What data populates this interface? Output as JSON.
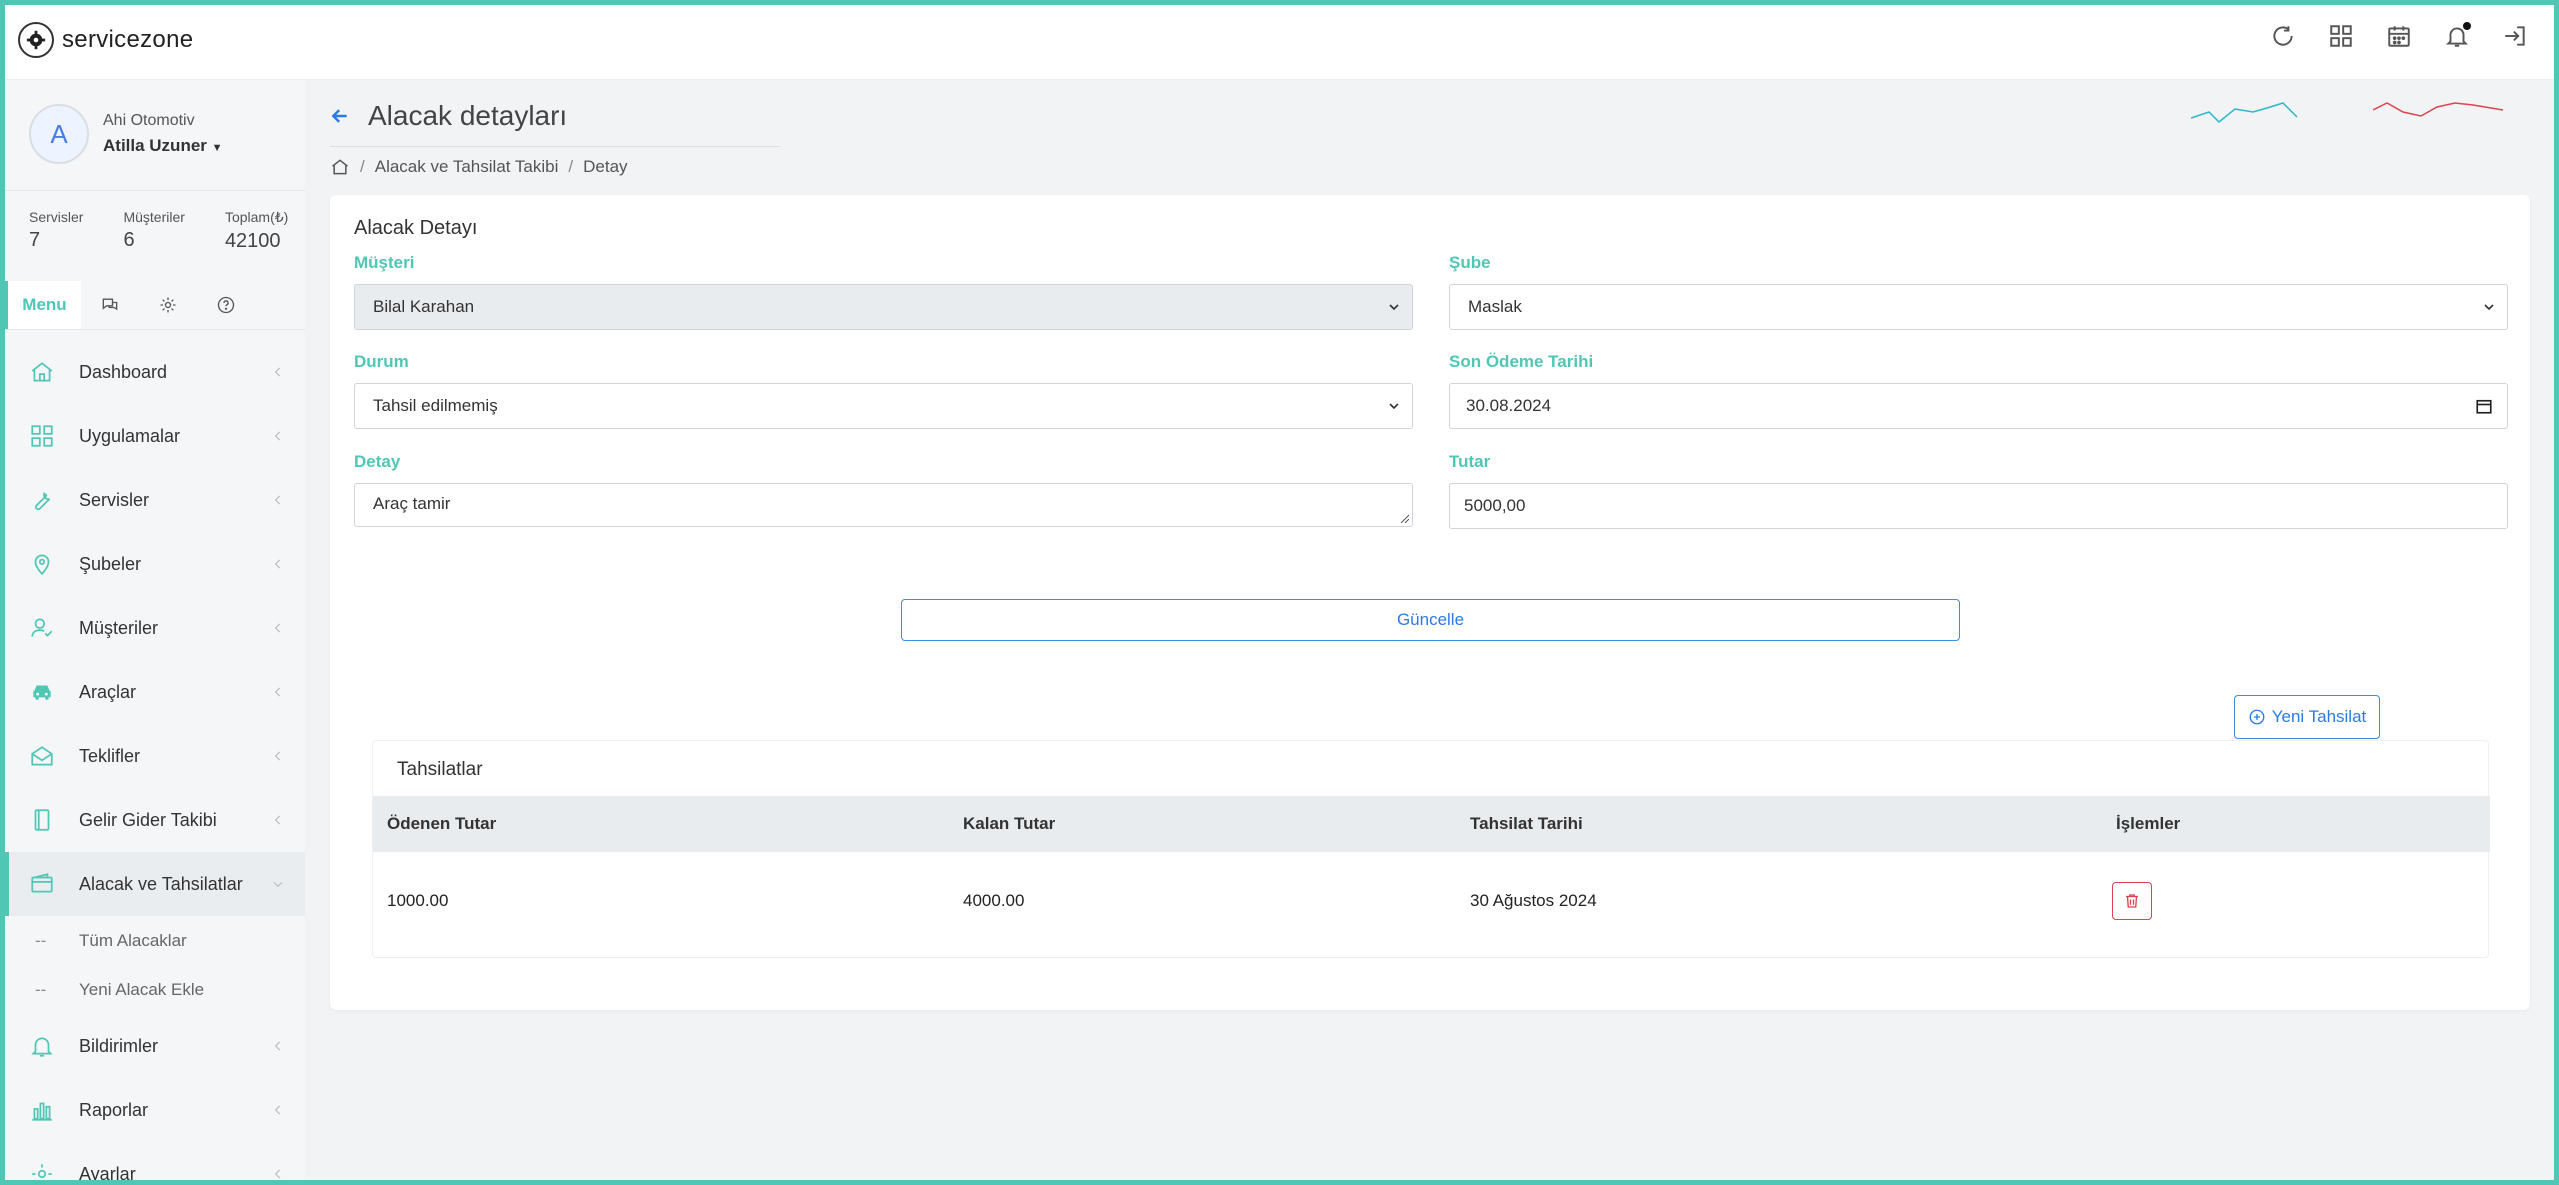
{
  "brand": {
    "name": "servicezone"
  },
  "profile": {
    "avatar_letter": "A",
    "company": "Ahi Otomotiv",
    "user": "Atilla Uzuner"
  },
  "stats": [
    {
      "label": "Servisler",
      "value": "7"
    },
    {
      "label": "Müşteriler",
      "value": "6"
    },
    {
      "label": "Toplam(₺)",
      "value": "42100"
    }
  ],
  "tabs": {
    "menu_label": "Menu"
  },
  "menu": {
    "items": [
      {
        "label": "Dashboard",
        "icon": "home-icon"
      },
      {
        "label": "Uygulamalar",
        "icon": "grid-icon"
      },
      {
        "label": "Servisler",
        "icon": "wrench-icon"
      },
      {
        "label": "Şubeler",
        "icon": "map-pin-icon"
      },
      {
        "label": "Müşteriler",
        "icon": "user-icon"
      },
      {
        "label": "Araçlar",
        "icon": "car-icon"
      },
      {
        "label": "Teklifler",
        "icon": "envelope-open-icon"
      },
      {
        "label": "Gelir Gider Takibi",
        "icon": "book-icon"
      },
      {
        "label": "Alacak ve Tahsilatlar",
        "icon": "wallet-icon"
      },
      {
        "label": "Bildirimler",
        "icon": "bell-icon"
      },
      {
        "label": "Raporlar",
        "icon": "bar-chart-icon"
      },
      {
        "label": "Ayarlar",
        "icon": "gear-icon"
      }
    ],
    "sub_items": [
      {
        "dash": "--",
        "label": "Tüm Alacaklar"
      },
      {
        "dash": "--",
        "label": "Yeni Alacak Ekle"
      }
    ]
  },
  "page": {
    "title": "Alacak detayları",
    "breadcrumb": [
      "Alacak ve Tahsilat Takibi",
      "Detay"
    ]
  },
  "form": {
    "card_title": "Alacak Detayı",
    "musteri": {
      "label": "Müşteri",
      "value": "Bilal Karahan"
    },
    "sube": {
      "label": "Şube",
      "value": "Maslak"
    },
    "durum": {
      "label": "Durum",
      "value": "Tahsil edilmemiş"
    },
    "son_odeme": {
      "label": "Son Ödeme Tarihi",
      "value": "30.08.2024"
    },
    "detay": {
      "label": "Detay",
      "value": "Araç tamir"
    },
    "tutar": {
      "label": "Tutar",
      "value": "5000,00"
    },
    "update_label": "Güncelle"
  },
  "collections": {
    "new_button": "Yeni Tahsilat",
    "title": "Tahsilatlar",
    "headers": [
      "Ödenen Tutar",
      "Kalan Tutar",
      "Tahsilat Tarihi",
      "İşlemler"
    ],
    "rows": [
      {
        "paid": "1000.00",
        "remaining": "4000.00",
        "date": "30 Ağustos 2024"
      }
    ]
  },
  "colors": {
    "accent": "#4fc7b4",
    "primary": "#2c7be5",
    "danger": "#e0424f",
    "spark_teal": "#2bb6c9",
    "spark_red": "#e0424f"
  }
}
